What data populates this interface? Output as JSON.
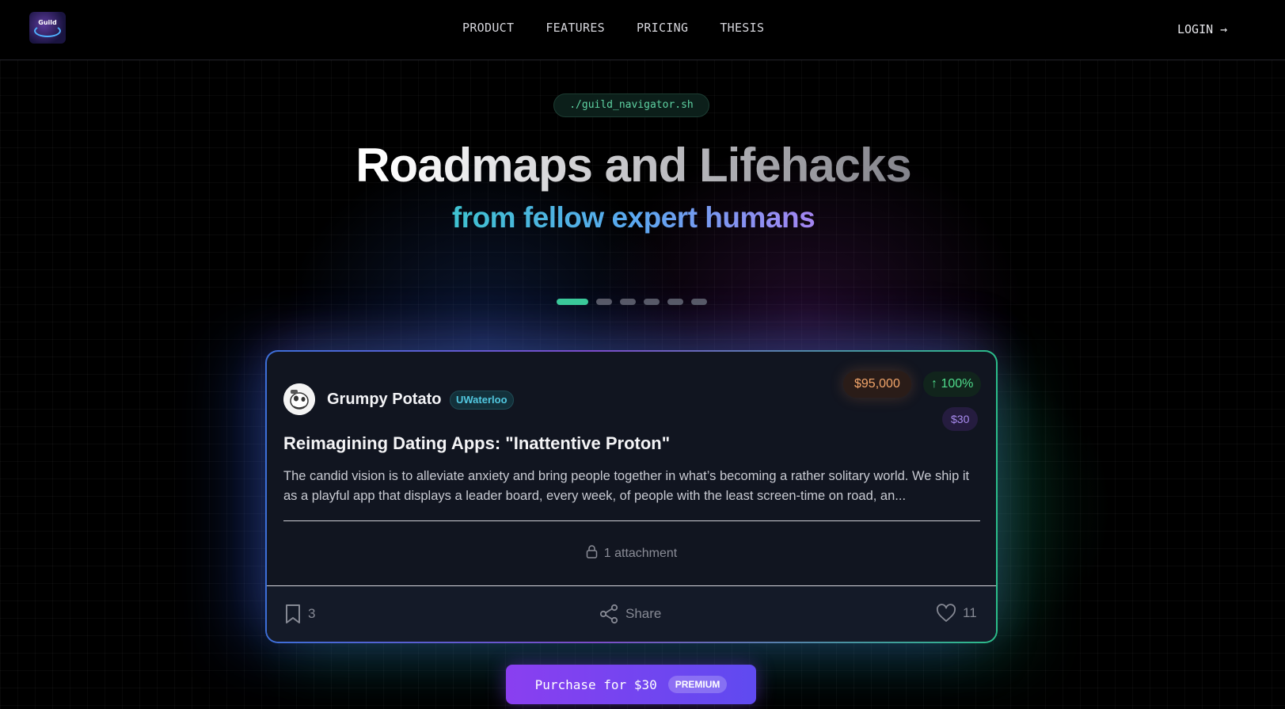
{
  "brand": {
    "logo_text": "Guild"
  },
  "nav": {
    "items": [
      "PRODUCT",
      "FEATURES",
      "PRICING",
      "THESIS"
    ],
    "login": "LOGIN →"
  },
  "hero": {
    "command": "./guild_navigator.sh",
    "headline": "Roadmaps and Lifehacks",
    "subline": "from fellow expert humans",
    "carousel": {
      "count": 6,
      "active_index": 0
    }
  },
  "card": {
    "author": "Grumpy Potato",
    "school": "UWaterloo",
    "price": "$95,000",
    "growth": "↑ 100%",
    "cost": "$30",
    "title": "Reimagining Dating Apps: \"Inattentive Proton\"",
    "description": "The candid vision is to alleviate anxiety and bring people together in what’s becoming a rather solitary world. We ship it as a playful app that displays a leader board, every week, of people with the least screen-time on road, an...",
    "attachment": "1 attachment",
    "bookmark_count": "3",
    "share_label": "Share",
    "like_count": "11"
  },
  "purchase": {
    "label": "Purchase for $30",
    "badge": "PREMIUM"
  },
  "colors": {
    "accent_green": "#3ccf9a",
    "accent_purple": "#8a3ff0",
    "price_orange": "#f2a56a"
  }
}
